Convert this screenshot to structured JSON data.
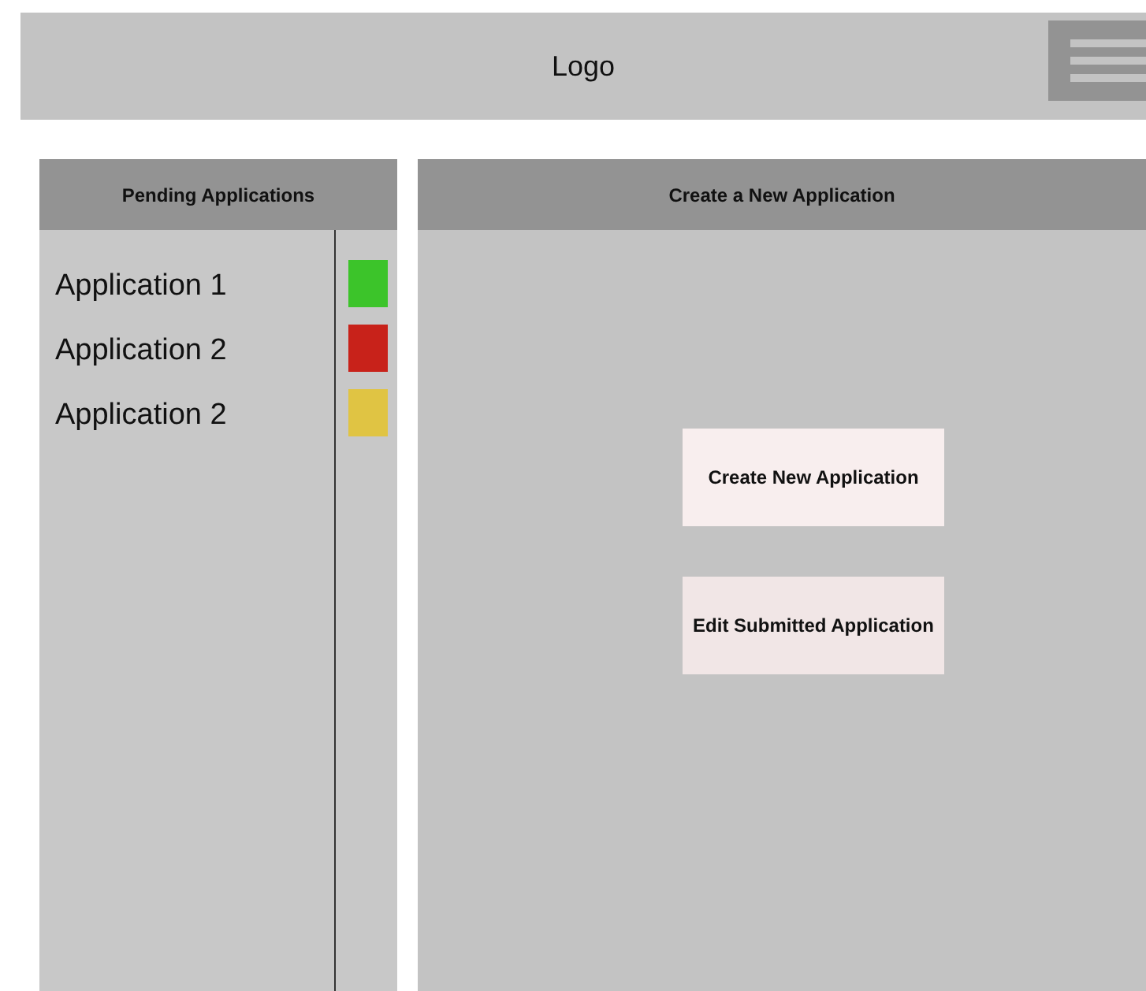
{
  "header": {
    "logo": "Logo"
  },
  "pending": {
    "title": "Pending Applications",
    "items": [
      {
        "name": "Application 1",
        "color": "#3cc42a"
      },
      {
        "name": "Application 2",
        "color": "#c8221a"
      },
      {
        "name": "Application 2",
        "color": "#e0c443"
      }
    ]
  },
  "create": {
    "title": "Create a New Application",
    "buttons": [
      "Create New Application",
      "Edit Submitted Application"
    ]
  }
}
